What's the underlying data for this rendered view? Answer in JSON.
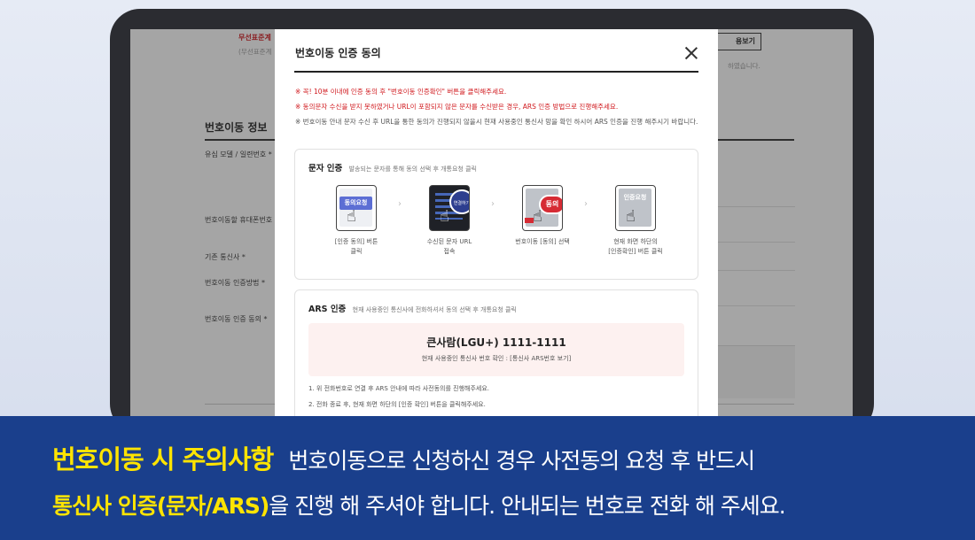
{
  "background_page": {
    "top_red_label": "무선표준계",
    "top_gray_label": "(무선표준계",
    "check_button": "용보기",
    "right_note": "하였습니다.",
    "section_title": "번호이동 정보",
    "field_labels": [
      "유심 모델 / 일련번호 *",
      "번호이동할 휴대폰번호",
      "기존 통신사 *",
      "번호이동 인증방법 *",
      "번호이동 인증 동의 *"
    ]
  },
  "modal": {
    "title": "번호이동 인증 동의",
    "notices": [
      "※ 꼭! 10분 이내에 인증 동의 후 \"번호이동 인증확인\" 버튼을 클릭해주세요.",
      "※ 동의문자 수신을 받지 못하였거나 URL이 포함되지 않은 문자를 수신받은 경우, ARS 인증 방법으로 진행해주세요.",
      "※ 번호이동 안내 문자 수신 후 URL을 통한 동의가 진행되지 않을시 현재 사용중인 통신사 망을 확인 하시어 ARS 인증을 진행 해주시기 바랍니다."
    ],
    "sms": {
      "title": "문자 인증",
      "desc": "발송되는 문자를 통해 동의 선택 후 개통요청 클릭",
      "steps": [
        {
          "phone_label": "동의요청",
          "caption_1": "[인증 동의] 버튼",
          "caption_2": "클릭"
        },
        {
          "phone_label": "연결하기",
          "caption_1": "수신된 문자 URL",
          "caption_2": "접속"
        },
        {
          "phone_label": "동의",
          "caption_1": "번호이동 [동의] 선택",
          "caption_2": ""
        },
        {
          "phone_label": "인증요청",
          "caption_1": "현재 화면 하단의",
          "caption_2": "[인증확인] 버튼 클릭"
        }
      ]
    },
    "ars": {
      "title": "ARS 인증",
      "desc": "현재 사용중인 통신사에 전화하셔서 동의 선택 후 개통요청 클릭",
      "number": "큰사람(LGU+) 1111-1111",
      "link_text": "현재 사용중인 통신사 번호 확인 : [통신사 ARS번호 보기]",
      "steps": [
        "1.  위 전화번호로 연결 후 ARS 안내에 따라 사전동의를 진행해주세요.",
        "2.  전화 종료 후, 현재 화면 하단의 [인증 확인] 버튼을 클릭해주세요."
      ]
    }
  },
  "banner": {
    "title": "번호이동 시 주의사항",
    "text_1": "번호이동으로 신청하신 경우 사전동의 요청 후 반드시",
    "highlight": "통신사 인증(문자/ARS)",
    "text_2": "을 진행 해 주셔야 합니다. 안내되는 번호로 전화 해 주세요."
  }
}
